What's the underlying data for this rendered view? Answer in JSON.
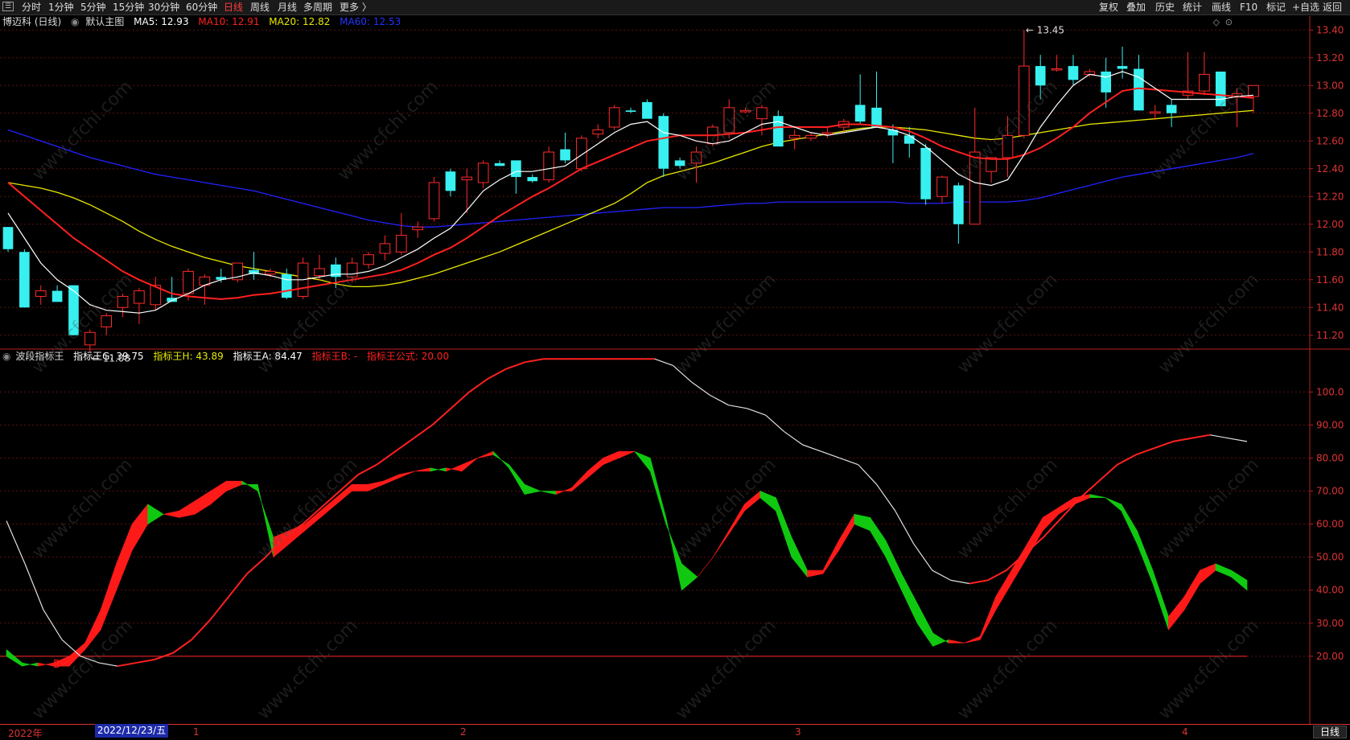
{
  "toolbar": {
    "left_tabs": [
      "分时",
      "1分钟",
      "5分钟",
      "15分钟",
      "30分钟",
      "60分钟",
      "日线",
      "周线",
      "月线",
      "多周期",
      "更多 〉"
    ],
    "active_tab": "日线",
    "right_tabs": [
      "复权",
      "叠加",
      "历史",
      "统计",
      "画线",
      "F10",
      "标记",
      "+自选",
      "返回"
    ]
  },
  "main_chart": {
    "title": "博迈科 (日线)",
    "layout_label": "默认主图",
    "ma5_label": "MA5: 12.93",
    "ma10_label": "MA10: 12.91",
    "ma20_label": "MA20: 12.82",
    "ma60_label": "MA60: 12.53",
    "high_label": "13.45",
    "low_label": "11.08",
    "colors": {
      "ma5": "#ffffff",
      "ma10": "#ff2020",
      "ma20": "#e8e800",
      "ma60": "#2222ff",
      "up": "#ff2a2a",
      "down": "#38f0f0"
    }
  },
  "indicator": {
    "name": "波段指标王",
    "g_label": "指标王G: 39.75",
    "h_label": "指标王H: 43.89",
    "a_label": "指标王A: 84.47",
    "b_label": "指标王B: -",
    "formula_label": "指标王公式: 20.00",
    "b_marker": "B",
    "colors": {
      "rise": "#ff1a1a",
      "fall": "#10c810",
      "a_line_up": "#ff2020",
      "a_line_down": "#e0e0e0",
      "baseline": "#d02020"
    }
  },
  "bottom_axis": {
    "year_label": "2022年",
    "cursor_date": "2022/12/23/五",
    "month_labels": [
      "1",
      "2",
      "3",
      "4"
    ],
    "period_button": "日线"
  },
  "watermark": "www.cfchi.com",
  "chart_data": [
    {
      "type": "candlestick",
      "title": "博迈科 (日线)",
      "ylim": [
        11.1,
        13.5
      ],
      "yticks": [
        "13.40",
        "13.20",
        "13.00",
        "12.80",
        "12.60",
        "12.40",
        "12.20",
        "12.00",
        "11.80",
        "11.60",
        "11.40",
        "11.20"
      ],
      "ohlc": [
        [
          11.98,
          11.98,
          11.8,
          11.82
        ],
        [
          11.8,
          11.82,
          11.4,
          11.4
        ],
        [
          11.48,
          11.56,
          11.42,
          11.52
        ],
        [
          11.52,
          11.56,
          11.45,
          11.44
        ],
        [
          11.56,
          11.56,
          11.2,
          11.2
        ],
        [
          11.13,
          11.24,
          11.08,
          11.22
        ],
        [
          11.26,
          11.36,
          11.2,
          11.34
        ],
        [
          11.4,
          11.5,
          11.33,
          11.48
        ],
        [
          11.43,
          11.54,
          11.28,
          11.52
        ],
        [
          11.42,
          11.62,
          11.38,
          11.56
        ],
        [
          11.47,
          11.62,
          11.46,
          11.44
        ],
        [
          11.5,
          11.68,
          11.45,
          11.66
        ],
        [
          11.56,
          11.64,
          11.42,
          11.62
        ],
        [
          11.62,
          11.68,
          11.58,
          11.6
        ],
        [
          11.6,
          11.72,
          11.58,
          11.72
        ],
        [
          11.67,
          11.8,
          11.6,
          11.64
        ],
        [
          11.64,
          11.68,
          11.62,
          11.66
        ],
        [
          11.64,
          11.68,
          11.46,
          11.47
        ],
        [
          11.48,
          11.76,
          11.46,
          11.72
        ],
        [
          11.63,
          11.78,
          11.6,
          11.68
        ],
        [
          11.71,
          11.76,
          11.54,
          11.62
        ],
        [
          11.62,
          11.76,
          11.58,
          11.72
        ],
        [
          11.71,
          11.8,
          11.68,
          11.78
        ],
        [
          11.79,
          11.92,
          11.74,
          11.86
        ],
        [
          11.8,
          12.08,
          11.78,
          11.92
        ],
        [
          11.96,
          12.02,
          11.9,
          11.98
        ],
        [
          12.04,
          12.34,
          12.02,
          12.3
        ],
        [
          12.38,
          12.4,
          12.2,
          12.24
        ],
        [
          12.32,
          12.4,
          12.08,
          12.34
        ],
        [
          12.3,
          12.46,
          12.26,
          12.44
        ],
        [
          12.44,
          12.46,
          12.42,
          12.42
        ],
        [
          12.46,
          12.46,
          12.22,
          12.34
        ],
        [
          12.34,
          12.36,
          12.3,
          12.31
        ],
        [
          12.32,
          12.56,
          12.3,
          12.52
        ],
        [
          12.54,
          12.66,
          12.44,
          12.46
        ],
        [
          12.4,
          12.64,
          12.38,
          12.62
        ],
        [
          12.65,
          12.72,
          12.62,
          12.68
        ],
        [
          12.7,
          12.86,
          12.68,
          12.84
        ],
        [
          12.82,
          12.84,
          12.8,
          12.81
        ],
        [
          12.88,
          12.9,
          12.76,
          12.76
        ],
        [
          12.78,
          12.8,
          12.34,
          12.4
        ],
        [
          12.46,
          12.48,
          12.4,
          12.42
        ],
        [
          12.44,
          12.56,
          12.3,
          12.52
        ],
        [
          12.58,
          12.72,
          12.56,
          12.7
        ],
        [
          12.66,
          12.9,
          12.62,
          12.84
        ],
        [
          12.81,
          12.84,
          12.8,
          12.82
        ],
        [
          12.76,
          12.86,
          12.64,
          12.84
        ],
        [
          12.78,
          12.82,
          12.58,
          12.56
        ],
        [
          12.62,
          12.68,
          12.54,
          12.64
        ],
        [
          12.62,
          12.66,
          12.6,
          12.64
        ],
        [
          12.65,
          12.7,
          12.62,
          12.66
        ],
        [
          12.7,
          12.76,
          12.66,
          12.74
        ],
        [
          12.86,
          13.08,
          12.72,
          12.74
        ],
        [
          12.84,
          13.1,
          12.76,
          12.7
        ],
        [
          12.68,
          12.72,
          12.44,
          12.64
        ],
        [
          12.64,
          12.7,
          12.48,
          12.58
        ],
        [
          12.55,
          12.58,
          12.14,
          12.18
        ],
        [
          12.2,
          12.35,
          12.15,
          12.34
        ],
        [
          12.28,
          12.3,
          11.86,
          12.0
        ],
        [
          12.0,
          12.84,
          12.0,
          12.52
        ],
        [
          12.38,
          12.48,
          12.3,
          12.48
        ],
        [
          12.48,
          12.78,
          12.34,
          12.64
        ],
        [
          12.64,
          13.4,
          12.62,
          13.14
        ],
        [
          13.14,
          13.22,
          12.9,
          13.0
        ],
        [
          13.12,
          13.22,
          13.1,
          13.12
        ],
        [
          13.14,
          13.22,
          13.0,
          13.04
        ],
        [
          13.08,
          13.12,
          13.06,
          13.1
        ],
        [
          13.1,
          13.2,
          12.84,
          12.95
        ],
        [
          13.14,
          13.28,
          13.05,
          13.12
        ],
        [
          13.12,
          13.22,
          12.82,
          12.82
        ],
        [
          12.8,
          12.86,
          12.75,
          12.81
        ],
        [
          12.86,
          12.9,
          12.7,
          12.8
        ],
        [
          12.93,
          13.24,
          12.9,
          12.96
        ],
        [
          12.96,
          13.24,
          12.93,
          13.08
        ],
        [
          13.1,
          13.1,
          12.88,
          12.85
        ],
        [
          12.92,
          12.98,
          12.7,
          12.94
        ],
        [
          12.92,
          13.0,
          12.8,
          13.0
        ]
      ],
      "ma5": [
        12.08,
        11.9,
        11.72,
        11.6,
        11.52,
        11.42,
        11.38,
        11.37,
        11.36,
        11.38,
        11.45,
        11.5,
        11.56,
        11.6,
        11.62,
        11.65,
        11.63,
        11.6,
        11.6,
        11.62,
        11.64,
        11.64,
        11.66,
        11.7,
        11.76,
        11.82,
        11.9,
        11.97,
        12.1,
        12.24,
        12.32,
        12.38,
        12.38,
        12.4,
        12.42,
        12.5,
        12.58,
        12.66,
        12.72,
        12.74,
        12.66,
        12.64,
        12.6,
        12.58,
        12.6,
        12.66,
        12.72,
        12.74,
        12.7,
        12.66,
        12.64,
        12.66,
        12.68,
        12.7,
        12.68,
        12.64,
        12.56,
        12.46,
        12.36,
        12.3,
        12.28,
        12.32,
        12.5,
        12.7,
        12.86,
        13.0,
        13.08,
        13.06,
        13.1,
        13.06,
        12.98,
        12.9,
        12.9,
        12.9,
        12.9,
        12.92,
        12.93
      ],
      "ma10": [
        12.3,
        12.2,
        12.1,
        12.0,
        11.9,
        11.82,
        11.74,
        11.66,
        11.6,
        11.55,
        11.5,
        11.48,
        11.47,
        11.46,
        11.47,
        11.49,
        11.5,
        11.52,
        11.54,
        11.56,
        11.58,
        11.6,
        11.62,
        11.64,
        11.67,
        11.72,
        11.78,
        11.83,
        11.9,
        11.98,
        12.06,
        12.13,
        12.2,
        12.26,
        12.33,
        12.4,
        12.45,
        12.5,
        12.55,
        12.6,
        12.62,
        12.64,
        12.64,
        12.64,
        12.65,
        12.66,
        12.68,
        12.7,
        12.7,
        12.7,
        12.7,
        12.72,
        12.72,
        12.71,
        12.7,
        12.67,
        12.62,
        12.56,
        12.52,
        12.48,
        12.47,
        12.47,
        12.5,
        12.55,
        12.62,
        12.7,
        12.8,
        12.88,
        12.96,
        12.98,
        12.97,
        12.96,
        12.95,
        12.94,
        12.93,
        12.92,
        12.91
      ],
      "ma20": [
        12.3,
        12.28,
        12.26,
        12.23,
        12.19,
        12.14,
        12.08,
        12.02,
        11.95,
        11.89,
        11.84,
        11.8,
        11.76,
        11.73,
        11.7,
        11.68,
        11.66,
        11.64,
        11.62,
        11.6,
        11.57,
        11.55,
        11.55,
        11.56,
        11.58,
        11.61,
        11.64,
        11.68,
        11.72,
        11.76,
        11.8,
        11.85,
        11.9,
        11.95,
        12.0,
        12.05,
        12.1,
        12.15,
        12.22,
        12.3,
        12.35,
        12.38,
        12.41,
        12.44,
        12.48,
        12.52,
        12.56,
        12.59,
        12.61,
        12.63,
        12.65,
        12.67,
        12.69,
        12.7,
        12.7,
        12.69,
        12.68,
        12.66,
        12.64,
        12.62,
        12.61,
        12.62,
        12.64,
        12.66,
        12.68,
        12.7,
        12.72,
        12.73,
        12.74,
        12.75,
        12.76,
        12.77,
        12.78,
        12.79,
        12.8,
        12.81,
        12.82
      ],
      "ma60": [
        12.68,
        12.64,
        12.6,
        12.56,
        12.52,
        12.48,
        12.45,
        12.42,
        12.39,
        12.36,
        12.34,
        12.32,
        12.3,
        12.28,
        12.26,
        12.24,
        12.21,
        12.18,
        12.15,
        12.12,
        12.09,
        12.06,
        12.03,
        12.01,
        11.99,
        11.98,
        11.98,
        11.99,
        12.0,
        12.01,
        12.02,
        12.03,
        12.04,
        12.05,
        12.06,
        12.07,
        12.08,
        12.09,
        12.1,
        12.11,
        12.12,
        12.12,
        12.12,
        12.13,
        12.14,
        12.15,
        12.15,
        12.16,
        12.16,
        12.16,
        12.16,
        12.16,
        12.16,
        12.16,
        12.16,
        12.15,
        12.15,
        12.15,
        12.16,
        12.16,
        12.16,
        12.16,
        12.17,
        12.19,
        12.22,
        12.25,
        12.28,
        12.31,
        12.34,
        12.36,
        12.38,
        12.4,
        12.42,
        12.44,
        12.46,
        12.48,
        12.51
      ]
    },
    {
      "type": "band",
      "title": "波段指标王",
      "ylim": [
        0,
        112
      ],
      "yticks": [
        "100.0",
        "90.00",
        "80.00",
        "70.00",
        "60.00",
        "50.00",
        "40.00",
        "30.00",
        "20.00"
      ],
      "g": [
        22,
        18,
        17,
        18,
        20,
        24,
        34,
        48,
        60,
        66,
        63,
        64,
        67,
        70,
        73,
        73,
        70,
        56,
        58,
        60,
        64,
        68,
        72,
        72,
        73,
        75,
        76,
        77,
        76,
        78,
        80,
        81,
        78,
        72,
        70,
        69,
        71,
        76,
        80,
        82,
        82,
        76,
        60,
        48,
        44,
        50,
        58,
        66,
        70,
        68,
        56,
        46,
        46,
        55,
        63,
        62,
        55,
        45,
        36,
        27,
        24,
        24,
        26,
        38,
        46,
        54,
        62,
        65,
        68,
        69,
        68,
        66,
        58,
        46,
        32,
        38,
        46,
        48,
        46,
        43
      ],
      "h": [
        20,
        17,
        18,
        17,
        17,
        22,
        28,
        40,
        52,
        60,
        63,
        62,
        63,
        66,
        70,
        72,
        72,
        50,
        54,
        58,
        62,
        66,
        70,
        70,
        72,
        74,
        76,
        76,
        77,
        76,
        80,
        82,
        77,
        69,
        70,
        70,
        70,
        74,
        78,
        80,
        82,
        80,
        62,
        40,
        44,
        50,
        57,
        64,
        68,
        64,
        50,
        44,
        45,
        52,
        60,
        58,
        50,
        40,
        30,
        23,
        25,
        24,
        25,
        34,
        42,
        50,
        58,
        63,
        66,
        68,
        68,
        64,
        54,
        42,
        28,
        34,
        42,
        46,
        44,
        40
      ],
      "a": [
        61,
        48,
        34,
        25,
        20,
        18,
        17,
        18,
        19,
        21,
        25,
        31,
        38,
        45,
        50,
        56,
        60,
        65,
        70,
        75,
        78,
        82,
        86,
        90,
        95,
        100,
        104,
        107,
        109,
        110,
        110,
        110,
        110,
        110,
        110,
        110,
        108,
        103,
        99,
        96,
        95,
        93,
        88,
        84,
        82,
        80,
        78,
        72,
        64,
        54,
        46,
        43,
        42,
        43,
        46,
        51,
        56,
        62,
        68,
        73,
        78,
        81,
        83,
        85,
        86,
        87,
        86,
        85
      ],
      "baseline": 20
    }
  ]
}
